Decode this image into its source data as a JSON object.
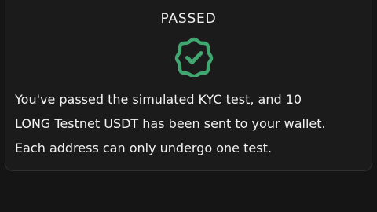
{
  "status": {
    "title": "PASSED",
    "icon": "check-badge-icon",
    "accent_color": "#3fa76f"
  },
  "message": {
    "lines": [
      "You've passed the simulated KYC test, and 10",
      "LONG Testnet USDT has been sent to your wallet.",
      "Each address can only undergo one test."
    ]
  }
}
